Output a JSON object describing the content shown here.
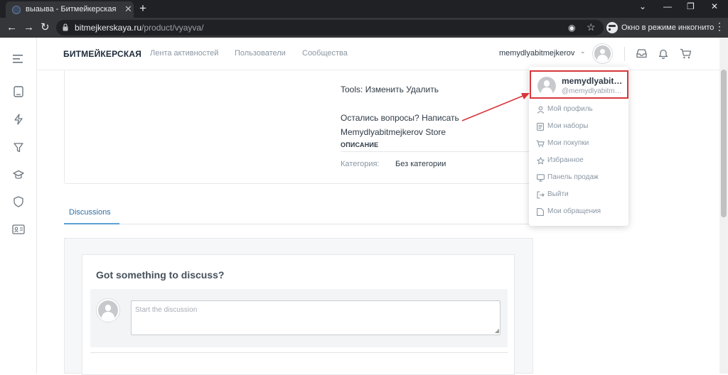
{
  "browser": {
    "tab_title": "выаыва - Битмейкерская",
    "url_host": "bitmejkerskaya.ru",
    "url_path": "/product/vyayva/",
    "incognito_label": "Окно в режиме инкогнито"
  },
  "header": {
    "logo": "БИТМЕЙКЕРСКАЯ",
    "nav": [
      "Лента активностей",
      "Пользователи",
      "Сообщества"
    ],
    "username": "memydlyabitmejkerov"
  },
  "product": {
    "tools_label": "Tools:",
    "tools_edit": "Изменить",
    "tools_delete": "Удалить",
    "questions_label": "Остались вопросы?",
    "questions_link": "Написать",
    "store_name": "Memydlyabitmejkerov Store",
    "description_heading": "ОПИСАНИЕ",
    "category_label": "Категория:",
    "category_value": "Без категории"
  },
  "discussions": {
    "tab_label": "Discussions",
    "title": "Got something to discuss?",
    "placeholder": "Start the discussion"
  },
  "dropdown": {
    "name": "memydlyabitmejkerov",
    "handle": "@memydlyabitmejkerov",
    "items": [
      {
        "label": "Мой профиль",
        "icon": "user-icon"
      },
      {
        "label": "Мои наборы",
        "icon": "document-icon"
      },
      {
        "label": "Мои покупки",
        "icon": "cart-icon"
      },
      {
        "label": "Избранное",
        "icon": "star-icon"
      },
      {
        "label": "Панель продаж",
        "icon": "monitor-icon"
      },
      {
        "label": "Выйти",
        "icon": "logout-icon"
      },
      {
        "label": "Мои обращения",
        "icon": "file-icon"
      }
    ]
  },
  "colors": {
    "highlight_border": "#d8363a",
    "annotation_arrow": "#d8363a",
    "tab_accent": "#5aa0d6"
  }
}
